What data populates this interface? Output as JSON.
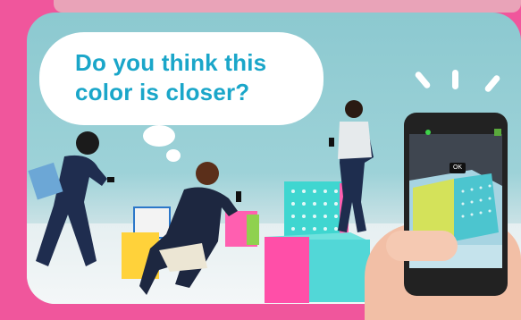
{
  "bubble": {
    "text": "Do you think this color is closer?"
  },
  "phone": {
    "ok_label": "OK"
  }
}
